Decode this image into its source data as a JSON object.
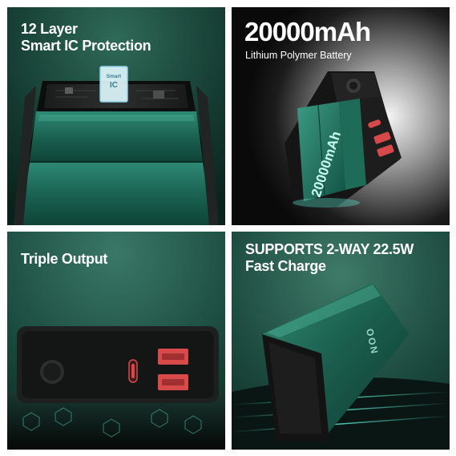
{
  "panels": [
    {
      "id": "protection",
      "heading_line1": "12 Layer",
      "heading_line2": "Smart IC Protection",
      "chip_line1": "Smart",
      "chip_line2": "IC"
    },
    {
      "id": "capacity",
      "heading": "20000mAh",
      "subheading": "Lithium Polymer Battery",
      "cell_label": "20000mAh"
    },
    {
      "id": "output",
      "heading": "Triple Output"
    },
    {
      "id": "charge",
      "heading_line1": "SUPPORTS 2-WAY 22.5W",
      "heading_line2": "Fast Charge",
      "brand_mark": "OON"
    }
  ],
  "colors": {
    "green_dark": "#0e3a30",
    "green_mid": "#1f6b58",
    "green_light": "#3aa58a",
    "usb_red": "#d84a4a",
    "glow_cyan": "#5ff2d8"
  },
  "icons": [
    "power-button-icon",
    "usb-c-port-icon",
    "usb-a-port-icon"
  ]
}
